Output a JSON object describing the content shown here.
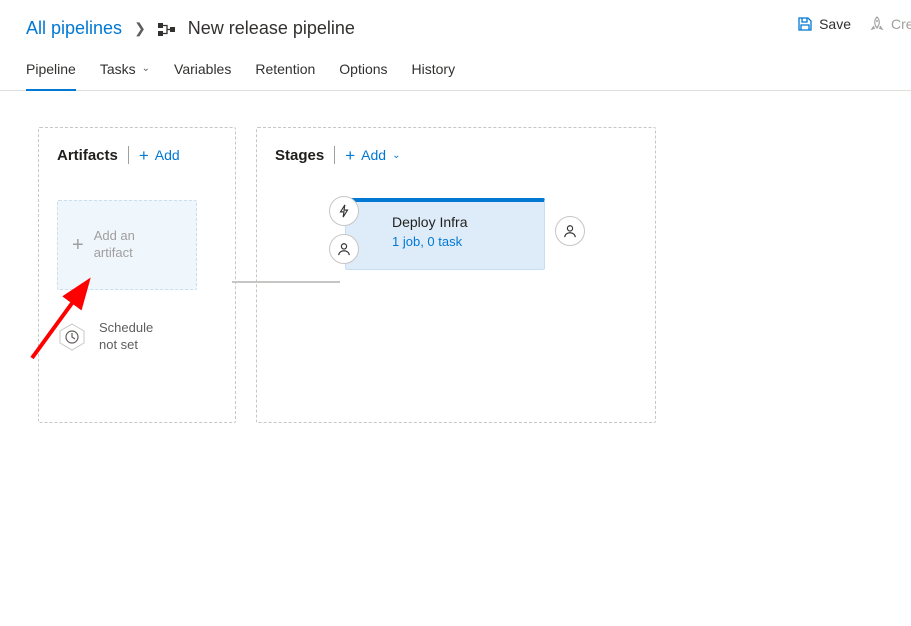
{
  "breadcrumb": {
    "root": "All pipelines",
    "title": "New release pipeline"
  },
  "topbar": {
    "save": "Save",
    "create": "Crea"
  },
  "tabs": {
    "pipeline": "Pipeline",
    "tasks": "Tasks",
    "variables": "Variables",
    "retention": "Retention",
    "options": "Options",
    "history": "History"
  },
  "artifacts": {
    "title": "Artifacts",
    "add": "Add",
    "placeholder_l1": "Add an",
    "placeholder_l2": "artifact",
    "schedule_l1": "Schedule",
    "schedule_l2": "not set"
  },
  "stages": {
    "title": "Stages",
    "add": "Add",
    "items": {
      "0": {
        "name": "Deploy Infra",
        "sub": "1 job, 0 task"
      }
    }
  }
}
